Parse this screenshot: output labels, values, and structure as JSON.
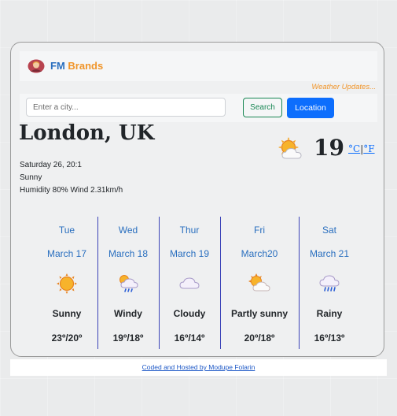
{
  "nav": {
    "brand_fm": "FM",
    "brand_rest": "Brands",
    "avatar_icon": "avatar-icon"
  },
  "tagline": "Weather Updates...",
  "search": {
    "placeholder": "Enter a city...",
    "search_label": "Search",
    "location_label": "Location"
  },
  "current": {
    "city": "London, UK",
    "datetime": "Saturday 26, 20:1",
    "condition": "Sunny",
    "humidity_wind": "Humidity 80% Wind 2.31km/h",
    "temp": "19",
    "unit_c": "°C",
    "unit_sep": "|",
    "unit_f": "°F",
    "icon": "partly-sunny-icon"
  },
  "forecast": [
    {
      "day": "Tue",
      "date": "March 17",
      "desc": "Sunny",
      "temps": "23º/20º",
      "icon": "sun-icon"
    },
    {
      "day": "Wed",
      "date": "March 18",
      "desc": "Windy",
      "temps": "19º/18º",
      "icon": "sun-rain-icon"
    },
    {
      "day": "Thur",
      "date": "March 19",
      "desc": "Cloudy",
      "temps": "16º/14º",
      "icon": "cloud-icon"
    },
    {
      "day": "Fri",
      "date": "March20",
      "desc": "Partly sunny",
      "temps": "20º/18º",
      "icon": "partly-sunny-icon"
    },
    {
      "day": "Sat",
      "date": "March 21",
      "desc": "Rainy",
      "temps": "16º/13º",
      "icon": "rain-icon"
    }
  ],
  "footer": {
    "credit": "Coded and Hosted by Modupe Folarin"
  },
  "colors": {
    "accent_blue": "#0d6efd",
    "brand_orange": "#f0952a",
    "search_green": "#198754",
    "divider": "#3b43b8"
  }
}
